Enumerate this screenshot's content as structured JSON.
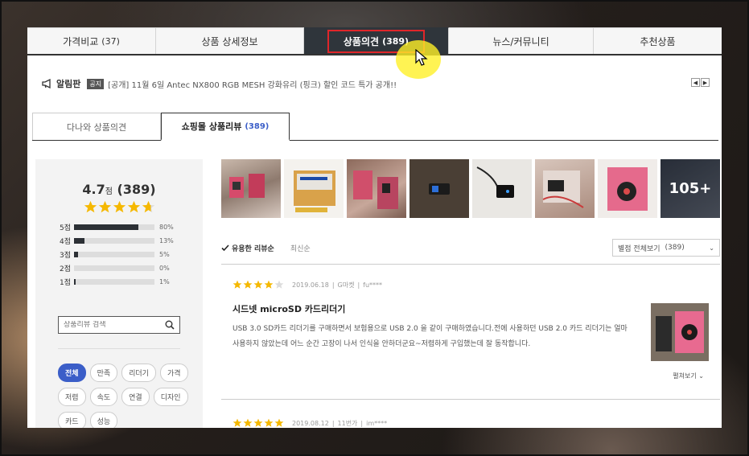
{
  "colors": {
    "accent": "#3b5ec8",
    "star": "#f5b800",
    "active_tab": "#2f353b",
    "highlight": "#e0262a"
  },
  "tabs": [
    {
      "label": "가격비교",
      "count": "(37)"
    },
    {
      "label": "상품 상세정보",
      "count": ""
    },
    {
      "label": "상품의견",
      "count": "(389)"
    },
    {
      "label": "뉴스/커뮤니티",
      "count": ""
    },
    {
      "label": "추천상품",
      "count": ""
    }
  ],
  "notice": {
    "icon": "megaphone-icon",
    "title": "알림판",
    "badge": "공지",
    "text": "[공개] 11월 6일 Antec NX800 RGB MESH 강화유리 (핑크) 할인 코드 특가 공개!!"
  },
  "subtabs": [
    {
      "label": "다나와 상품의견",
      "count": ""
    },
    {
      "label": "쇼핑몰 상품리뷰",
      "count": "(389)"
    }
  ],
  "summary": {
    "score": "4.7",
    "unit": "점",
    "count": "(389)",
    "rating": 4.7,
    "distribution": [
      {
        "label": "5점",
        "pct": "80%",
        "value": 80
      },
      {
        "label": "4점",
        "pct": "13%",
        "value": 13
      },
      {
        "label": "3점",
        "pct": "5%",
        "value": 5
      },
      {
        "label": "2점",
        "pct": "0%",
        "value": 0
      },
      {
        "label": "1점",
        "pct": "1%",
        "value": 1
      }
    ]
  },
  "search": {
    "placeholder": "상품리뷰 검색"
  },
  "chips": [
    "전체",
    "만족",
    "리더기",
    "가격",
    "저렴",
    "속도",
    "연결",
    "디자인",
    "카드",
    "성능"
  ],
  "thumbs": {
    "more": "105+"
  },
  "sort": {
    "helpful": "유용한 리뷰순",
    "latest": "최신순",
    "filter": "별점 전체보기",
    "filter_count": "(389)"
  },
  "reviews": [
    {
      "rating": 4,
      "date": "2019.06.18",
      "mall": "G마켓",
      "user": "fu****",
      "title": "시드넷 microSD 카드리더기",
      "body": "USB 3.0 SD카드 리더기를 구매하면서 보험용으로 USB 2.0 을 같이 구매하였습니다.전에 사용하던 USB 2.0 카드 리더기는 얼마 사용하지 않았는데 어느 순간 고장이 나서 인식을 안하더군요~저렴하게 구입했는데 잘 동작합니다.",
      "expand": "펼쳐보기"
    },
    {
      "rating": 5,
      "date": "2019.08.12",
      "mall": "11번가",
      "user": "im****"
    }
  ]
}
